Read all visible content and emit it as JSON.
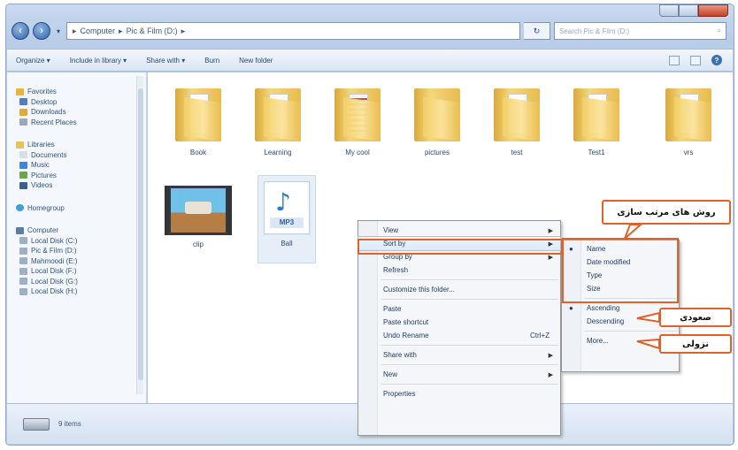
{
  "window": {
    "address": [
      "Computer",
      "Pic & Film (D:)"
    ],
    "search_placeholder": "Search Pic & Film (D:)"
  },
  "toolbar": {
    "organize": "Organize ▾",
    "include": "Include in library ▾",
    "share": "Share with ▾",
    "burn": "Burn",
    "new_folder": "New folder"
  },
  "sidebar": {
    "favorites": "Favorites",
    "favorites_items": [
      "Desktop",
      "Downloads",
      "Recent Places"
    ],
    "libraries": "Libraries",
    "libraries_items": [
      "Documents",
      "Music",
      "Pictures",
      "Videos"
    ],
    "homegroup": "Homegroup",
    "computer": "Computer",
    "computer_items": [
      "Local Disk (C:)",
      "Pic & Film (D:)",
      "Mahmoodi (E:)",
      "Local Disk (F:)",
      "Local Disk (G:)",
      "Local Disk (H:)"
    ]
  },
  "files": {
    "folders": [
      "Book",
      "Learning",
      "My cool",
      "pictures",
      "test",
      "Test1",
      "vrs"
    ],
    "video": "clip",
    "audio": "Ball",
    "audio_badge": "MP3"
  },
  "context_menu": {
    "view": "View",
    "sort_by": "Sort by",
    "group_by": "Group by",
    "refresh": "Refresh",
    "customize": "Customize this folder...",
    "paste": "Paste",
    "paste_shortcut": "Paste shortcut",
    "undo": "Undo Rename",
    "undo_shortcut": "Ctrl+Z",
    "share_with": "Share with",
    "new": "New",
    "properties": "Properties"
  },
  "sort_menu": {
    "name": "Name",
    "date_modified": "Date modified",
    "type": "Type",
    "size": "Size",
    "ascending": "Ascending",
    "descending": "Descending",
    "more": "More..."
  },
  "annotations": {
    "sort_methods": "روش های مرتب سازی",
    "ascending": "صعودی",
    "descending": "نزولی"
  },
  "status": {
    "items": "9 items"
  },
  "colors": {
    "annotation": "#e0622a",
    "folder": "#f3cf67"
  }
}
